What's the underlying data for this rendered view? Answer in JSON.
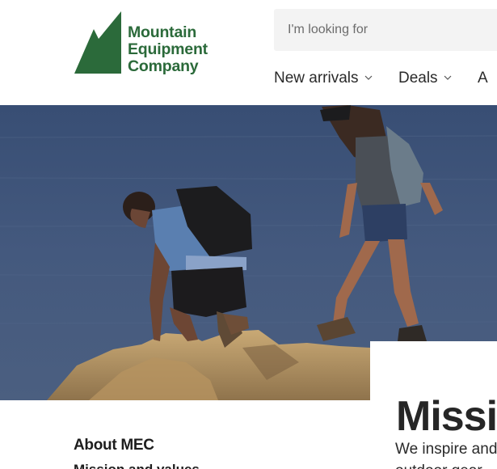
{
  "brand": {
    "name_lines": [
      "Mountain",
      "Equipment",
      "Company"
    ],
    "color": "#2b6a3a"
  },
  "search": {
    "placeholder": "I'm looking for"
  },
  "nav": {
    "items": [
      {
        "label": "New arrivals",
        "icon": "chevron-down-icon"
      },
      {
        "label": "Deals",
        "icon": "chevron-down-icon"
      },
      {
        "label": "A",
        "icon": ""
      }
    ]
  },
  "hero": {
    "image": "hikers-on-rocky-coast",
    "heading": "Missio"
  },
  "side_nav": {
    "heading": "About MEC",
    "links": [
      "Mission and values"
    ]
  },
  "main": {
    "lines": [
      "We inspire and",
      "outdoor gear"
    ]
  },
  "colors": {
    "accent": "#2b6a3a",
    "hero_sea": "#41567a"
  }
}
